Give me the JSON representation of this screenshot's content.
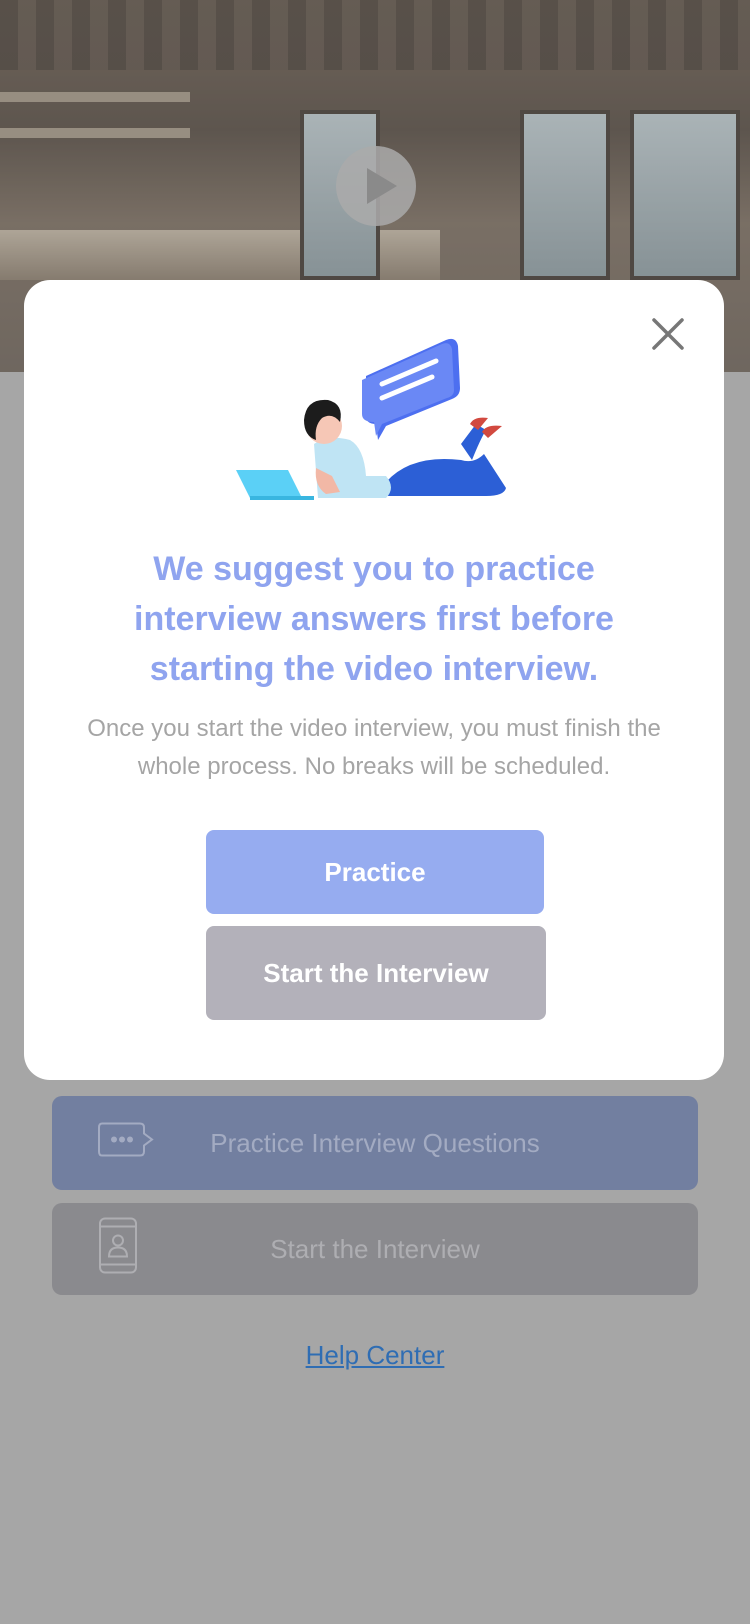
{
  "background": {
    "buttons": {
      "practice_label": "Practice Interview Questions",
      "start_label": "Start the Interview"
    },
    "help_link": "Help Center"
  },
  "modal": {
    "title": "We suggest you to practice interview answers first before starting the video interview.",
    "description": "Once you start the video interview, you must finish the whole process. No breaks will be scheduled.",
    "practice_button": "Practice",
    "start_button": "Start the Interview"
  },
  "icons": {
    "play": "play-icon",
    "close": "close-icon",
    "chat": "chat-bubble-icon",
    "phone": "phone-user-icon"
  },
  "colors": {
    "accent": "#96acf0",
    "title": "#8fa4ef",
    "secondary_button": "#b3b1ba",
    "overlay": "#a6a6a6",
    "link": "#2f6db3"
  }
}
